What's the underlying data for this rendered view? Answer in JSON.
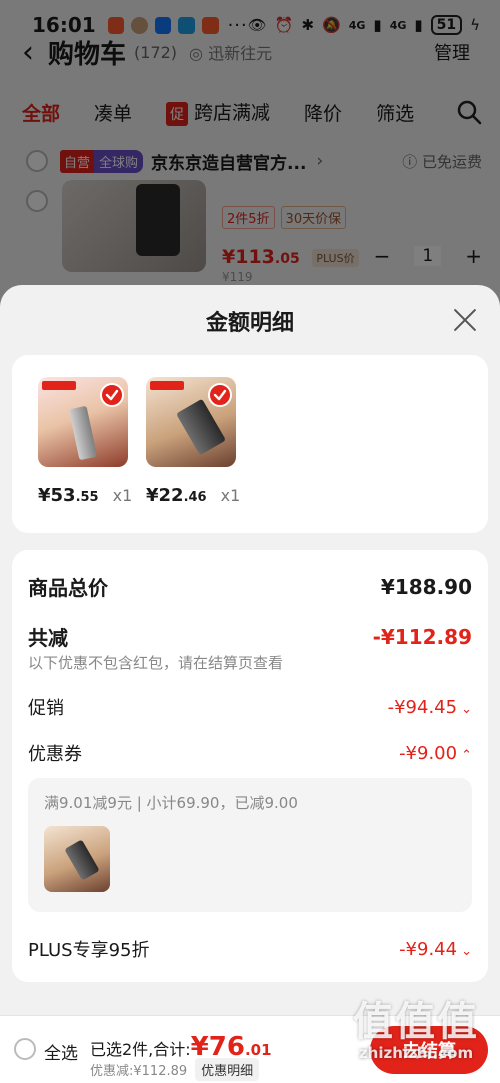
{
  "status_bar": {
    "time": "16:01",
    "apps": [
      "taobao-app-icon",
      "avatar-app-icon",
      "alipay-app-icon",
      "browser-app-icon",
      "taobao-app-icon"
    ],
    "more": "···",
    "network": "4G",
    "battery": "51"
  },
  "cart_header": {
    "title": "购物车",
    "count": "(172)",
    "address": "◎ 迅新往元",
    "manage": "管理"
  },
  "filter_tabs": {
    "items": [
      "全部",
      "凑单",
      "跨店满减",
      "降价",
      "筛选"
    ],
    "promo_tag": "促"
  },
  "store": {
    "self_tag": "自营",
    "global_tag": "全球购",
    "name": "京东京造自营官方...",
    "free_shipping": "ⓘ 已免运费"
  },
  "bg_product": {
    "tags": [
      "2件5折",
      "30天价保"
    ],
    "price_int": "¥113",
    "price_dec": ".05",
    "plus_tag": "PLUS价",
    "qty": "1",
    "minus": "−",
    "plus": "+",
    "old_price": "¥119"
  },
  "sheet": {
    "title": "金额明细",
    "items": [
      {
        "price_int": "¥53",
        "price_dec": ".55",
        "qty": "x1"
      },
      {
        "price_int": "¥22",
        "price_dec": ".46",
        "qty": "x1"
      }
    ],
    "goods_total": {
      "label": "商品总价",
      "value": "¥188.90"
    },
    "total_discount": {
      "label": "共减",
      "value": "-¥112.89"
    },
    "note": "以下优惠不包含红包，请在结算页查看",
    "promotion": {
      "label": "促销",
      "value": "-¥94.45"
    },
    "coupon": {
      "label": "优惠券",
      "value": "-¥9.00"
    },
    "coupon_detail": "满9.01减9元 | 小计69.90，已减9.00",
    "plus_discount": {
      "label": "PLUS专享95折",
      "value": "-¥9.44"
    }
  },
  "bottom_bar": {
    "select_all": "全选",
    "selected_text": "已选2件,合计:",
    "total_int": "¥76",
    "total_dec": ".01",
    "discount_text": "优惠减:¥112.89",
    "detail_button": "优惠明细",
    "checkout": "去结算"
  },
  "watermark": {
    "logo": "值值值",
    "domain": "zhizhizhi.com"
  },
  "colors": {
    "accent_red": "#e2231a",
    "global_purple": "#6a4cc9",
    "sheet_bg": "#f1f1f1"
  }
}
